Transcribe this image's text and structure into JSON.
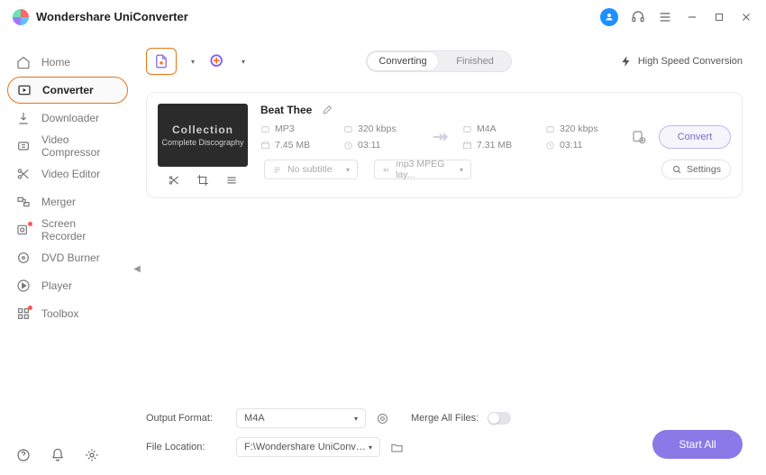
{
  "app": {
    "title": "Wondershare UniConverter"
  },
  "sidebar": {
    "items": [
      {
        "label": "Home"
      },
      {
        "label": "Converter"
      },
      {
        "label": "Downloader"
      },
      {
        "label": "Video Compressor"
      },
      {
        "label": "Video Editor"
      },
      {
        "label": "Merger"
      },
      {
        "label": "Screen Recorder"
      },
      {
        "label": "DVD Burner"
      },
      {
        "label": "Player"
      },
      {
        "label": "Toolbox"
      }
    ]
  },
  "tabs": {
    "converting": "Converting",
    "finished": "Finished"
  },
  "hsc": "High Speed Conversion",
  "file": {
    "title": "Beat Thee",
    "thumb1": "Collection",
    "thumb2": "Complete Discography",
    "src": {
      "format": "MP3",
      "bitrate": "320 kbps",
      "size": "7.45 MB",
      "dur": "03:11"
    },
    "dst": {
      "format": "M4A",
      "bitrate": "320 kbps",
      "size": "7.31 MB",
      "dur": "03:11"
    },
    "convert": "Convert",
    "subtitle": "No subtitle",
    "audiotrack": "mp3 MPEG lay...",
    "settings": "Settings"
  },
  "bottom": {
    "outputLabel": "Output Format:",
    "outputValue": "M4A",
    "mergeLabel": "Merge All Files:",
    "locationLabel": "File Location:",
    "locationValue": "F:\\Wondershare UniConverter",
    "startAll": "Start All"
  }
}
